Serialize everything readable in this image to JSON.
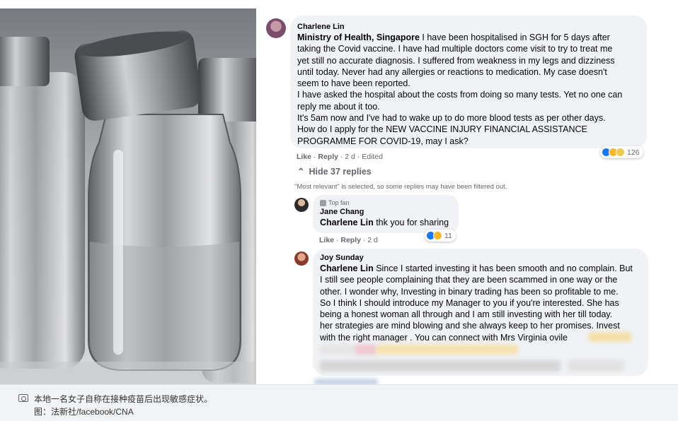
{
  "comment1": {
    "author": "Charlene Lin",
    "mention": "Ministry of Health, Singapore",
    "lines": [
      " I have been hospitalised in SGH for 5 days after",
      "taking the Covid vaccine. I have had multiple doctors come visit to try to treat me",
      "yet still no accurate diagnosis. I suffered from weakness in my legs and dizziness",
      "until today. Never had any allergies or reactions to medication. My case doesn't",
      "seem to have been reported.",
      "I have asked the hospital about the costs from doing so many tests. Yet no one can",
      "reply me about it too.",
      "It's 5am now and I've had to wake up to do more blood tests as per other days.",
      "How do I apply for the NEW VACCINE INJURY FINANCIAL ASSISTANCE",
      "PROGRAMME FOR COVID-19, may I ask?"
    ],
    "like": "Like",
    "reply": "Reply",
    "meta": "· 2 d · Edited",
    "reaction_count": "126"
  },
  "hide_replies": "Hide 37 replies",
  "filter_note": "\"Most relevant\" is selected, so some replies may have been filtered out.",
  "reply1": {
    "badge": "Top fan",
    "author": "Jane Chang",
    "mention": "Charlene Lin",
    "text": " thk you for sharing",
    "like": "Like",
    "reply": "Reply",
    "meta": "· 2 d",
    "reaction_count": "11"
  },
  "reply2": {
    "author": "Joy Sunday",
    "mention": "Charlene Lin",
    "lines": [
      " Since I started investing it has been smooth and no complain. But",
      "I still see people complaining that they are been scammed in one way or the",
      "other. I wonder why, Investing in binary trading has been so profitable to me.",
      "So I think I should introduce my Manager to you if you're interested. She has",
      "being a honest woman all through and I am still investing with her till today.",
      "her strategies are mind blowing and she always keep to her promises. Invest",
      "with the right manager . You can connect with Mrs Virginia ovile"
    ]
  },
  "caption": {
    "line1": "本地一名女子自称在接种疫苗后出现敏感症状。",
    "line2": "图：法新社/facebook/CNA"
  },
  "colors": {
    "fb_gray_bubble": "#f0f2f5",
    "fb_meta": "#65676b",
    "like_blue": "#1877f2",
    "caption_bg": "#f2f3f4"
  },
  "icons": {
    "camera": "camera-icon",
    "chevron": "chevron-up-icon",
    "badge": "top-fan-badge-icon"
  }
}
